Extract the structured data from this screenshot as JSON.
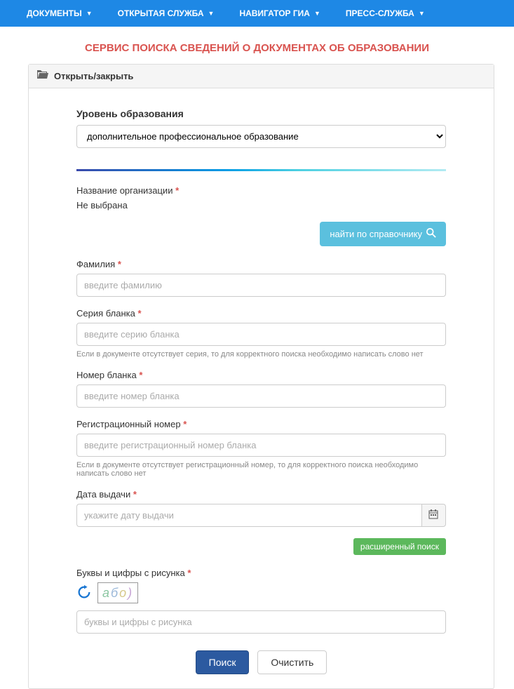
{
  "nav": {
    "items": [
      {
        "label": "ДОКУМЕНТЫ"
      },
      {
        "label": "ОТКРЫТАЯ СЛУЖБА"
      },
      {
        "label": "НАВИГАТОР ГИА"
      },
      {
        "label": "ПРЕСС-СЛУЖБА"
      }
    ]
  },
  "page": {
    "title": "СЕРВИС ПОИСКА СВЕДЕНИЙ О ДОКУМЕНТАХ ОБ ОБРАЗОВАНИИ"
  },
  "panel": {
    "header": "Открыть/закрыть"
  },
  "form": {
    "education_level": {
      "label": "Уровень образования",
      "selected": "дополнительное профессиональное образование"
    },
    "organization": {
      "label": "Название организации",
      "value": "Не выбрана",
      "lookup_button": "найти по справочнику"
    },
    "surname": {
      "label": "Фамилия",
      "placeholder": "введите фамилию"
    },
    "blank_series": {
      "label": "Серия бланка",
      "placeholder": "введите серию бланка",
      "hint": "Если в документе отсутствует серия, то для корректного поиска необходимо написать слово нет"
    },
    "blank_number": {
      "label": "Номер бланка",
      "placeholder": "введите номер бланка"
    },
    "reg_number": {
      "label": "Регистрационный номер",
      "placeholder": "введите регистрационный номер бланка",
      "hint": "Если в документе отсутствует регистрационный номер, то для корректного поиска необходимо написать слово нет"
    },
    "issue_date": {
      "label": "Дата выдачи",
      "placeholder": "укажите дату выдачи"
    },
    "advanced_search": "расширенный поиск",
    "captcha": {
      "label": "Буквы и цифры с рисунка",
      "placeholder": "буквы и цифры с рисунка"
    },
    "actions": {
      "search": "Поиск",
      "clear": "Очистить"
    }
  }
}
